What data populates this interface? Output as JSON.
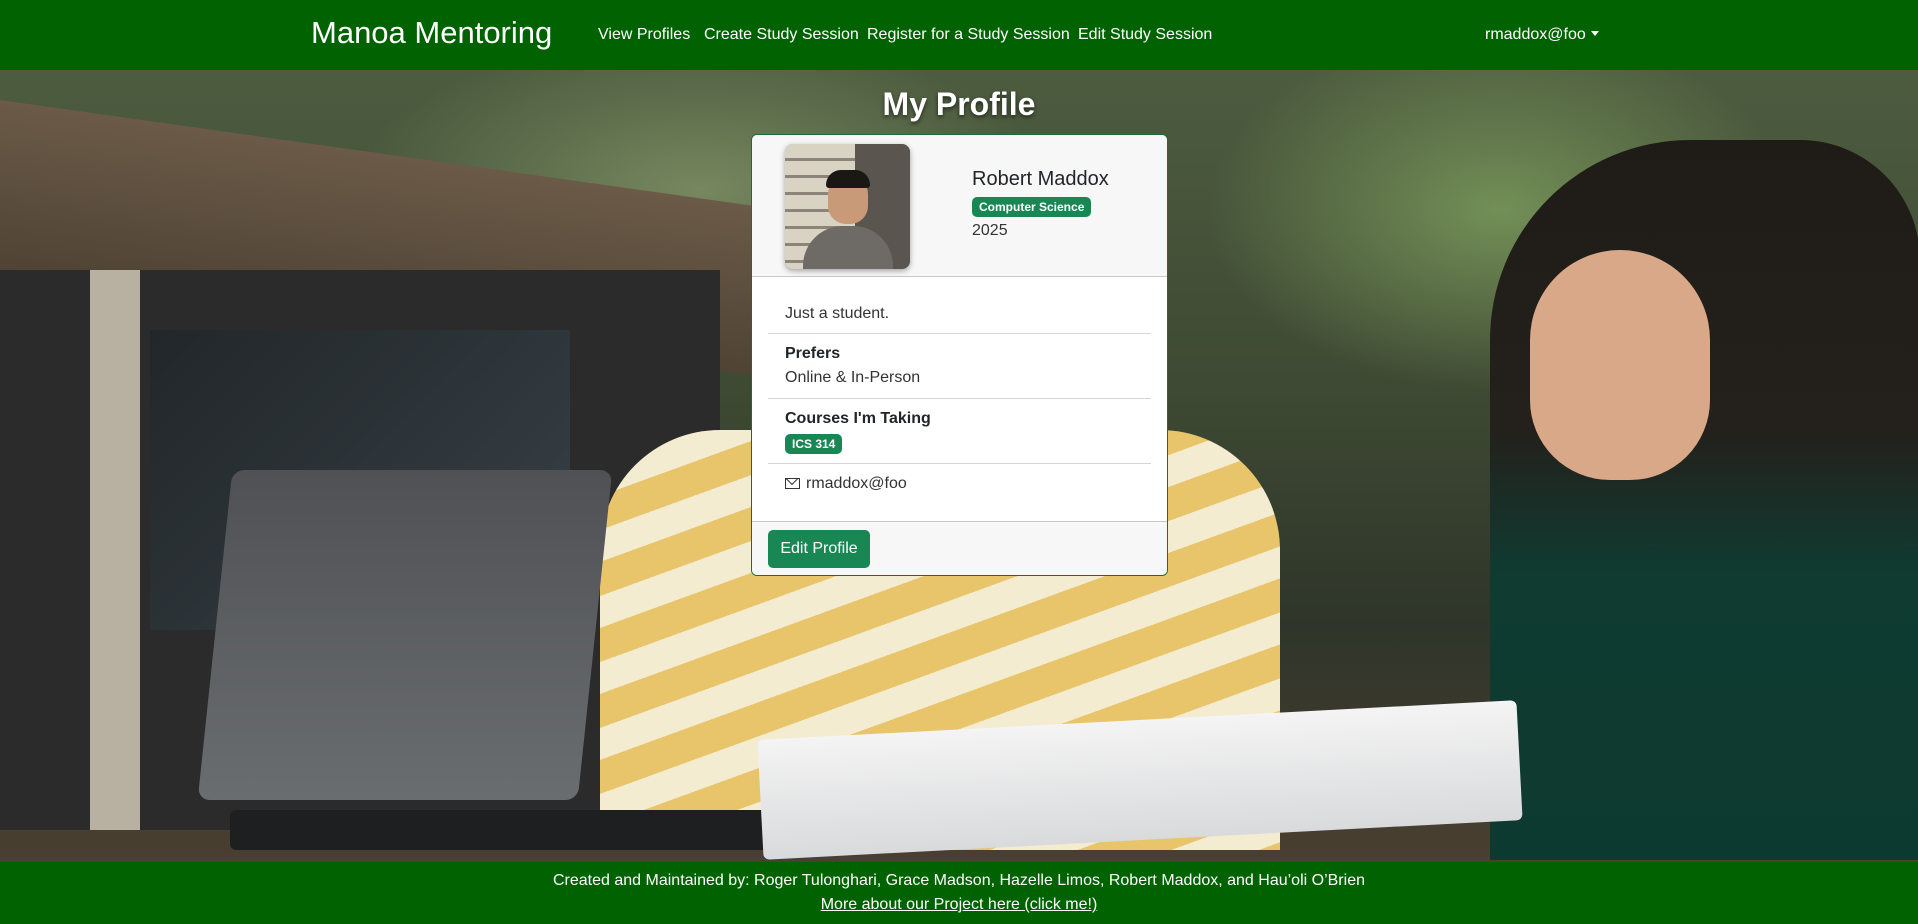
{
  "navbar": {
    "brand": "Manoa Mentoring",
    "links": [
      "View Profiles",
      "Create Study Session",
      "Register for a Study Session",
      "Edit Study Session"
    ],
    "user": "rmaddox@foo"
  },
  "page": {
    "title": "My Profile"
  },
  "profile": {
    "name": "Robert Maddox",
    "major": "Computer Science",
    "year": "2025",
    "bio": "Just a student.",
    "prefers_label": "Prefers",
    "prefers_value": "Online & In-Person",
    "courses_label": "Courses I'm Taking",
    "courses": [
      "ICS 314"
    ],
    "email": "rmaddox@foo",
    "edit_button": "Edit Profile"
  },
  "footer": {
    "credits": "Created and Maintained by: Roger Tulonghari, Grace Madson, Hazelle Limos, Robert Maddox, and Hau’oli O’Brien",
    "link_text": "More about our Project here (click me!)"
  },
  "colors": {
    "navbar": "#016201",
    "badge": "#198754",
    "button": "#198754"
  },
  "icons": [
    "envelope-icon",
    "caret-down-icon"
  ]
}
